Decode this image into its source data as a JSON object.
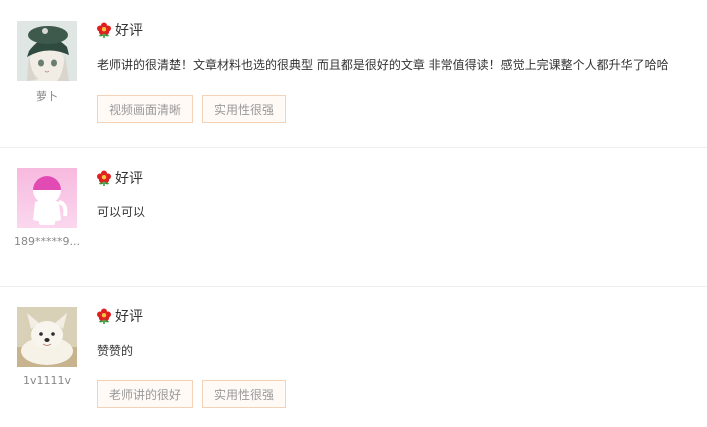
{
  "reviews": [
    {
      "username": "萝卜",
      "avatar_icon": "anime-girl-avatar-icon",
      "rating_icon": "red-flower-icon",
      "rating_label": "好评",
      "comment": "老师讲的很清楚！文章材料也选的很典型 而且都是很好的文章 非常值得读！感觉上完课整个人都升华了哈哈",
      "tags": [
        "视频画面清晰",
        "实用性很强"
      ]
    },
    {
      "username": "189*****9...",
      "avatar_icon": "default-pink-avatar-icon",
      "rating_icon": "red-flower-icon",
      "rating_label": "好评",
      "comment": "可以可以",
      "tags": []
    },
    {
      "username": "1v1111v",
      "avatar_icon": "white-dog-avatar-icon",
      "rating_icon": "red-flower-icon",
      "rating_label": "好评",
      "comment": "赞赞的",
      "tags": [
        "老师讲的很好",
        "实用性很强"
      ]
    }
  ],
  "colors": {
    "tag_border": "#f3d2b8",
    "tag_background": "#fffaf6",
    "flower_red": "#e02020",
    "flower_green": "#3a9a3a",
    "divider": "#eeeeee"
  }
}
